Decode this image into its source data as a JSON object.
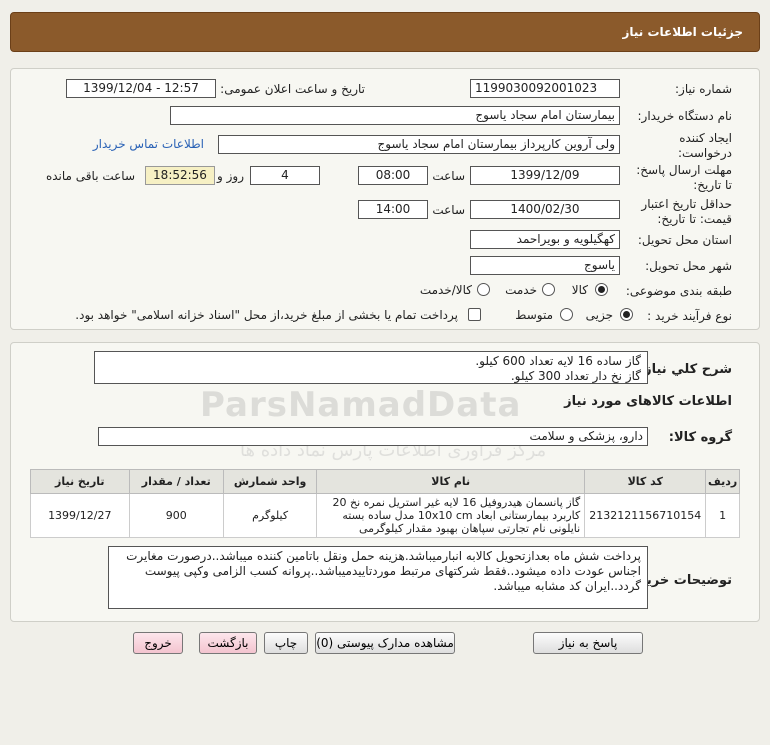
{
  "header": {
    "title": "جزئیات اطلاعات نیاز"
  },
  "form": {
    "need_number_label": "شماره نیاز:",
    "need_number": "1199030092001023",
    "announce_label": "تاریخ و ساعت اعلان عمومی:",
    "announce_value": "1399/12/04 - 12:57",
    "buyer_org_label": "نام دستگاه خریدار:",
    "buyer_org": "بیمارستان امام سجاد یاسوج",
    "creator_label_1": "ایجاد کننده",
    "creator_label_2": "درخواست:",
    "creator": "ولی آروین کارپرداز بیمارستان امام سجاد یاسوج",
    "contact_link": "اطلاعات تماس خریدار",
    "deadline_label_1": "مهلت ارسال پاسخ:",
    "deadline_label_2": "تا تاریخ:",
    "deadline_date": "1399/12/09",
    "time_label": "ساعت",
    "deadline_time": "08:00",
    "days_value": "4",
    "days_label": "روز و",
    "remaining_time": "18:52:56",
    "remaining_label": "ساعت باقی مانده",
    "validity_label_1": "حداقل تاریخ اعتبار",
    "validity_label_2": "قیمت: تا تاریخ:",
    "validity_date": "1400/02/30",
    "validity_time": "14:00",
    "province_label": "استان محل تحویل:",
    "province": "کهگیلویه و بویراحمد",
    "city_label": "شهر محل تحویل:",
    "city": "یاسوج",
    "category_label": "طبقه بندی موضوعی:",
    "category_options": [
      "کالا",
      "خدمت",
      "کالا/خدمت"
    ],
    "category_selected": "کالا",
    "process_label": "نوع فرآیند خرید :",
    "process_options": [
      "جزیی",
      "متوسط"
    ],
    "process_selected": "جزیی",
    "payment_note": "پرداخت تمام یا بخشی از مبلغ خرید،از محل \"اسناد خزانه اسلامی\" خواهد بود."
  },
  "summary": {
    "label": "شرح كلي نياز:",
    "line1": "گاز ساده 16 لایه تعداد 600 کیلو.",
    "line2": "گاز نخ دار تعداد 300 کیلو."
  },
  "goods": {
    "section_title": "اطلاعات کالاهای مورد نیاز",
    "group_label": "گروه کالا:",
    "group_value": "دارو، پزشکی و سلامت",
    "columns": [
      "ردیف",
      "کد کالا",
      "نام کالا",
      "واحد شمارش",
      "تعداد / مقدار",
      "تاریخ نیاز"
    ],
    "rows": [
      {
        "index": "1",
        "code": "2132121156710154",
        "name": "گاز پانسمان هیدروفیل 16 لایه غیر استریل نمره نخ 20 کاربرد بیمارستانی ابعاد 10x10 cm مدل ساده بسته نایلونی نام تجارتی سپاهان بهبود مقدار کیلوگرمی",
        "unit": "کیلوگرم",
        "qty": "900",
        "date": "1399/12/27"
      }
    ]
  },
  "buyer_notes": {
    "label": "توضیحات خریدار:",
    "text": "پرداخت شش ماه بعدازتحویل کالابه انبارمیباشد.هزینه حمل ونقل باتامین کننده میباشد..درصورت مغایرت اجناس عودت داده میشود..فقط شرکتهای مرتبط موردتاییدمیباشد..پروانه کسب الزامی وکپی پیوست گردد..ایران کد مشابه میباشد."
  },
  "buttons": {
    "reply": "پاسخ به نیاز",
    "attachments": "مشاهده مدارک پیوستی (0)",
    "print": "چاپ",
    "back": "بازگشت",
    "exit": "خروج"
  },
  "watermark": {
    "brand": "ParsNamadData",
    "sub": "مرکز فرآوری اطلاعات پارس نماد داده ها"
  }
}
